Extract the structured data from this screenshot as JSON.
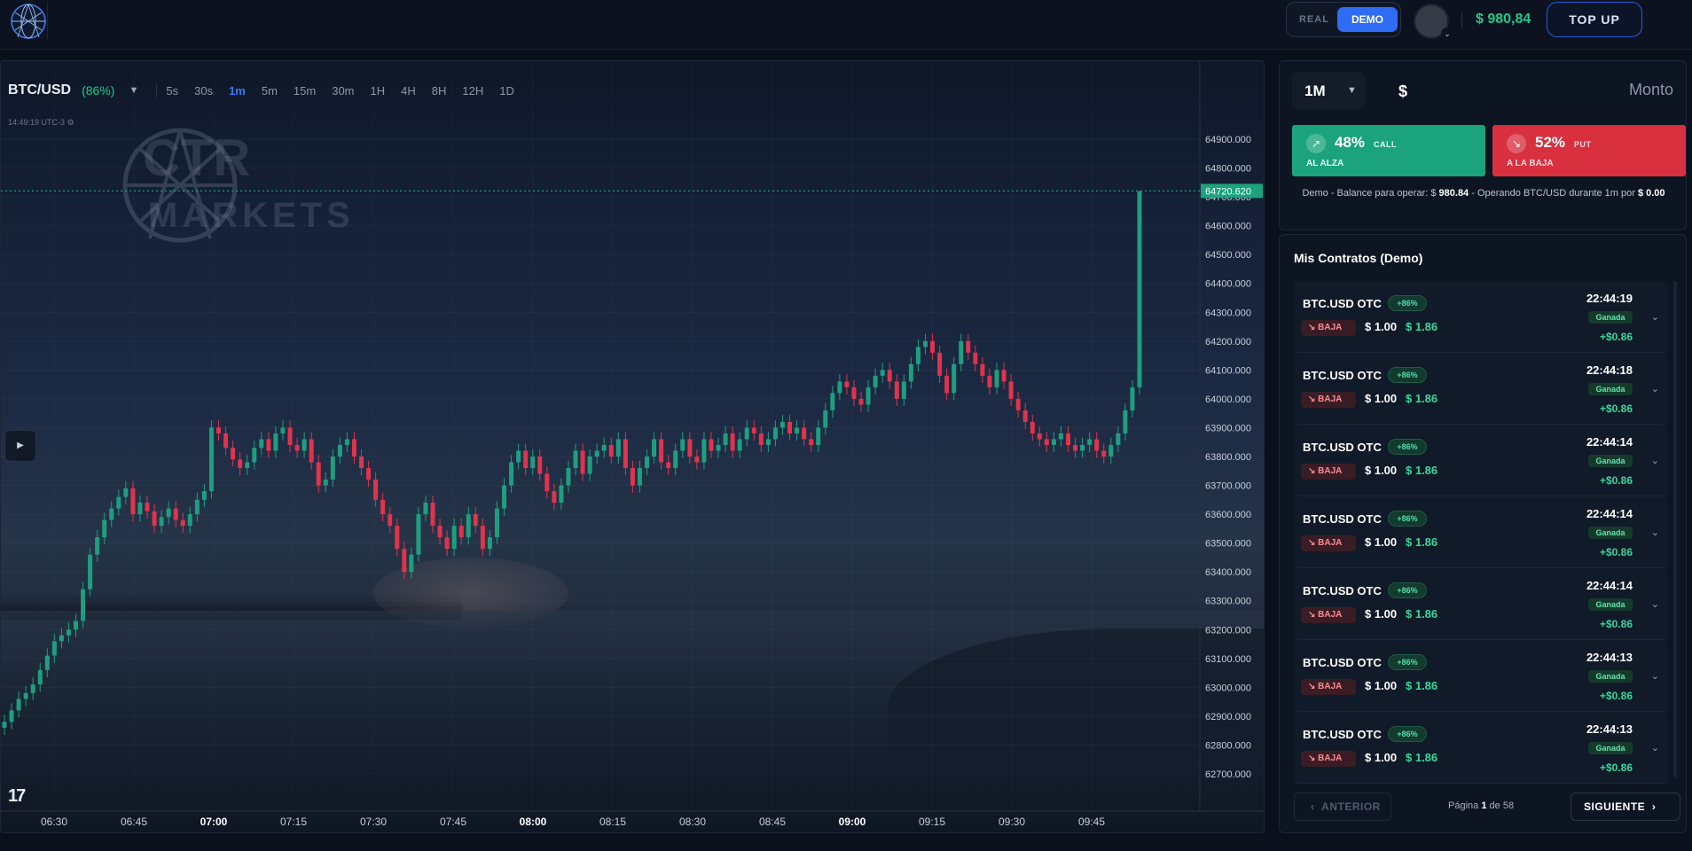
{
  "header": {
    "mode_real": "REAL",
    "mode_demo": "DEMO",
    "balance": "$ 980,84",
    "topup_label": "TOP UP"
  },
  "chart": {
    "symbol": "BTC/USD",
    "payout": "(86%)",
    "timeframes": [
      "5s",
      "30s",
      "1m",
      "5m",
      "15m",
      "30m",
      "1H",
      "4H",
      "8H",
      "12H",
      "1D"
    ],
    "active_timeframe": "1m",
    "clock": "14:49:19 UTC-3",
    "watermark_line1": "CTR",
    "watermark_line2": "MARKETS",
    "tv_logo": "17",
    "colors": {
      "up": "#1f9e7f",
      "down": "#e0334c",
      "price_tag": "#1aa37c"
    }
  },
  "chart_data": {
    "type": "candlestick",
    "x_ticks": [
      "06:30",
      "06:45",
      "07:00",
      "07:15",
      "07:30",
      "07:45",
      "08:00",
      "08:15",
      "08:30",
      "08:45",
      "09:00",
      "09:15",
      "09:30",
      "09:45"
    ],
    "y_ticks": [
      "64900.000",
      "64800.000",
      "64700.000",
      "64600.000",
      "64500.000",
      "64400.000",
      "64300.000",
      "64200.000",
      "64100.000",
      "64000.000",
      "63900.000",
      "63800.000",
      "63700.000",
      "63600.000",
      "63500.000",
      "63400.000",
      "63300.000",
      "63200.000",
      "63100.000",
      "63000.000",
      "62900.000",
      "62800.000",
      "62700.000"
    ],
    "ylim": [
      62700,
      64900
    ],
    "current_price": "64720.620",
    "current_value": 64720.62,
    "series": [
      {
        "name": "price",
        "values": [
          62880,
          62920,
          62960,
          62980,
          63010,
          63060,
          63110,
          63160,
          63180,
          63200,
          63230,
          63340,
          63460,
          63520,
          63580,
          63620,
          63660,
          63690,
          63600,
          63640,
          63610,
          63560,
          63590,
          63620,
          63580,
          63560,
          63600,
          63650,
          63680,
          63900,
          63880,
          63830,
          63790,
          63760,
          63780,
          63830,
          63860,
          63820,
          63880,
          63900,
          63840,
          63820,
          63860,
          63780,
          63700,
          63720,
          63800,
          63840,
          63860,
          63800,
          63760,
          63720,
          63650,
          63600,
          63560,
          63480,
          63400,
          63460,
          63600,
          63640,
          63560,
          63520,
          63480,
          63560,
          63520,
          63600,
          63560,
          63480,
          63520,
          63620,
          63700,
          63780,
          63820,
          63760,
          63800,
          63740,
          63680,
          63640,
          63700,
          63760,
          63820,
          63740,
          63800,
          63820,
          63840,
          63800,
          63860,
          63760,
          63700,
          63760,
          63800,
          63860,
          63780,
          63760,
          63820,
          63860,
          63800,
          63780,
          63860,
          63820,
          63840,
          63880,
          63820,
          63860,
          63900,
          63880,
          63840,
          63860,
          63900,
          63920,
          63880,
          63900,
          63860,
          63840,
          63900,
          63960,
          64020,
          64060,
          64040,
          64000,
          63980,
          64040,
          64080,
          64100,
          64060,
          64000,
          64060,
          64120,
          64180,
          64200,
          64160,
          64080,
          64020,
          64120,
          64200,
          64160,
          64120,
          64080,
          64040,
          64100,
          64060,
          64000,
          63960,
          63920,
          63880,
          63860,
          63840,
          63860,
          63880,
          63840,
          63820,
          63840,
          63860,
          63820,
          63800,
          63840,
          63880,
          63960,
          64040,
          64720
        ]
      }
    ]
  },
  "trade": {
    "duration": "1M",
    "currency": "$",
    "amount_placeholder": "Monto",
    "call_pct": "48%",
    "call_kind": "CALL",
    "call_sub": "AL ALZA",
    "put_pct": "52%",
    "put_kind": "PUT",
    "put_sub": "A LA BAJA",
    "info_prefix": "Demo - Balance para operar: $",
    "info_balance": "980.84",
    "info_mid": "- Operando BTC/USD durante 1m por",
    "info_amount": "$ 0.00"
  },
  "contracts": {
    "title": "Mis Contratos (Demo)",
    "items": [
      {
        "asset": "BTC.USD OTC",
        "badge": "+86%",
        "direction": "BAJA",
        "stake": "$ 1.00",
        "payout": "$ 1.86",
        "time": "22:44:19",
        "status": "Ganada",
        "profit": "+$0.86"
      },
      {
        "asset": "BTC.USD OTC",
        "badge": "+86%",
        "direction": "BAJA",
        "stake": "$ 1.00",
        "payout": "$ 1.86",
        "time": "22:44:18",
        "status": "Ganada",
        "profit": "+$0.86"
      },
      {
        "asset": "BTC.USD OTC",
        "badge": "+86%",
        "direction": "BAJA",
        "stake": "$ 1.00",
        "payout": "$ 1.86",
        "time": "22:44:14",
        "status": "Ganada",
        "profit": "+$0.86"
      },
      {
        "asset": "BTC.USD OTC",
        "badge": "+86%",
        "direction": "BAJA",
        "stake": "$ 1.00",
        "payout": "$ 1.86",
        "time": "22:44:14",
        "status": "Ganada",
        "profit": "+$0.86"
      },
      {
        "asset": "BTC.USD OTC",
        "badge": "+86%",
        "direction": "BAJA",
        "stake": "$ 1.00",
        "payout": "$ 1.86",
        "time": "22:44:14",
        "status": "Ganada",
        "profit": "+$0.86"
      },
      {
        "asset": "BTC.USD OTC",
        "badge": "+86%",
        "direction": "BAJA",
        "stake": "$ 1.00",
        "payout": "$ 1.86",
        "time": "22:44:13",
        "status": "Ganada",
        "profit": "+$0.86"
      },
      {
        "asset": "BTC.USD OTC",
        "badge": "+86%",
        "direction": "BAJA",
        "stake": "$ 1.00",
        "payout": "$ 1.86",
        "time": "22:44:13",
        "status": "Ganada",
        "profit": "+$0.86"
      }
    ],
    "pager": {
      "prev": "ANTERIOR",
      "page_prefix": "Página",
      "page": "1",
      "page_mid": "de",
      "total": "58",
      "next": "SIGUIENTE"
    }
  }
}
